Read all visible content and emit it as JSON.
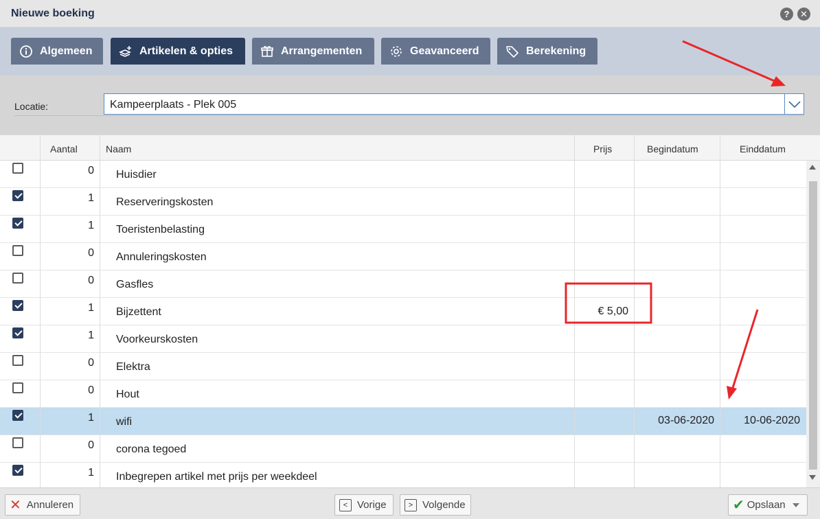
{
  "window": {
    "title": "Nieuwe boeking",
    "help_icon": "question-icon",
    "close_icon": "close-icon"
  },
  "tabs": [
    {
      "label": "Algemeen",
      "icon": "info-icon",
      "active": false
    },
    {
      "label": "Artikelen & opties",
      "icon": "layers-plus-icon",
      "active": true
    },
    {
      "label": "Arrangementen",
      "icon": "gift-icon",
      "active": false
    },
    {
      "label": "Geavanceerd",
      "icon": "gear-icon",
      "active": false
    },
    {
      "label": "Berekening",
      "icon": "tag-icon",
      "active": false
    }
  ],
  "location": {
    "label": "Locatie:",
    "value": "Kampeerplaats - Plek 005"
  },
  "table": {
    "headers": {
      "aantal": "Aantal",
      "naam": "Naam",
      "prijs": "Prijs",
      "begindatum": "Begindatum",
      "einddatum": "Einddatum"
    },
    "rows": [
      {
        "checked": false,
        "qty": "0",
        "name": "Huisdier",
        "price": "",
        "start": "",
        "end": "",
        "selected": false
      },
      {
        "checked": true,
        "qty": "1",
        "name": "Reserveringskosten",
        "price": "",
        "start": "",
        "end": "",
        "selected": false
      },
      {
        "checked": true,
        "qty": "1",
        "name": "Toeristenbelasting",
        "price": "",
        "start": "",
        "end": "",
        "selected": false
      },
      {
        "checked": false,
        "qty": "0",
        "name": "Annuleringskosten",
        "price": "",
        "start": "",
        "end": "",
        "selected": false
      },
      {
        "checked": false,
        "qty": "0",
        "name": "Gasfles",
        "price": "",
        "start": "",
        "end": "",
        "selected": false
      },
      {
        "checked": true,
        "qty": "1",
        "name": "Bijzettent",
        "price": "€ 5,00",
        "start": "",
        "end": "",
        "selected": false
      },
      {
        "checked": true,
        "qty": "1",
        "name": "Voorkeurskosten",
        "price": "",
        "start": "",
        "end": "",
        "selected": false
      },
      {
        "checked": false,
        "qty": "0",
        "name": "Elektra",
        "price": "",
        "start": "",
        "end": "",
        "selected": false
      },
      {
        "checked": false,
        "qty": "0",
        "name": "Hout",
        "price": "",
        "start": "",
        "end": "",
        "selected": false
      },
      {
        "checked": true,
        "qty": "1",
        "name": "wifi",
        "price": "",
        "start": "03-06-2020",
        "end": "10-06-2020",
        "selected": true
      },
      {
        "checked": false,
        "qty": "0",
        "name": "corona tegoed",
        "price": "",
        "start": "",
        "end": "",
        "selected": false
      },
      {
        "checked": true,
        "qty": "1",
        "name": "Inbegrepen artikel met prijs per weekdeel",
        "price": "",
        "start": "",
        "end": "",
        "selected": false
      }
    ]
  },
  "footer": {
    "cancel": "Annuleren",
    "previous": "Vorige",
    "next": "Volgende",
    "save": "Opslaan"
  },
  "colors": {
    "active_tab": "#2b3e5e",
    "inactive_tab": "#66748e",
    "selected_row": "#c2dcf0",
    "annotation": "#e8262a"
  }
}
